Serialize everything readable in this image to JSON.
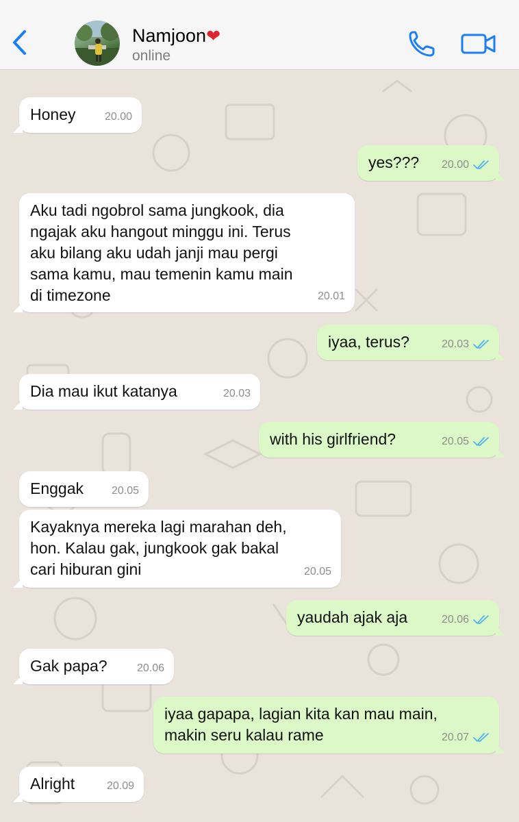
{
  "header": {
    "contact_name": "Namjoon",
    "heart": "❤",
    "status": "online"
  },
  "colors": {
    "incoming_bubble": "#ffffff",
    "outgoing_bubble": "#dcf8c6",
    "accent_blue": "#1a7ef5",
    "read_check": "#4fb3f2"
  },
  "messages": [
    {
      "dir": "in",
      "text": "Honey",
      "time": "20.00"
    },
    {
      "dir": "out",
      "text": "yes???",
      "time": "20.00",
      "read": true
    },
    {
      "dir": "in",
      "text": "Aku tadi ngobrol sama jungkook, dia\nngajak aku hangout minggu ini. Terus\naku bilang aku udah janji mau pergi\nsama kamu, mau temenin kamu main\ndi timezone",
      "time": "20.01"
    },
    {
      "dir": "out",
      "text": "iyaa, terus?",
      "time": "20.03",
      "read": true
    },
    {
      "dir": "in",
      "text": "Dia mau ikut katanya",
      "time": "20.03"
    },
    {
      "dir": "out",
      "text": "with his girlfriend?",
      "time": "20.05",
      "read": true
    },
    {
      "dir": "in",
      "text": "Enggak",
      "time": "20.05"
    },
    {
      "dir": "in",
      "text": "Kayaknya mereka lagi marahan deh,\nhon. Kalau gak, jungkook gak bakal\ncari hiburan gini",
      "time": "20.05"
    },
    {
      "dir": "out",
      "text": "yaudah ajak aja",
      "time": "20.06",
      "read": true
    },
    {
      "dir": "in",
      "text": "Gak papa?",
      "time": "20.06"
    },
    {
      "dir": "out",
      "text": "iyaa gapapa, lagian kita kan mau main,\nmakin seru kalau rame",
      "time": "20.07",
      "read": true
    },
    {
      "dir": "in",
      "text": "Alright",
      "time": "20.09"
    }
  ]
}
